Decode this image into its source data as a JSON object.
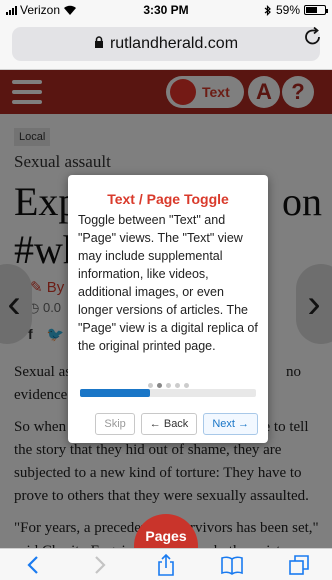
{
  "status_bar": {
    "carrier": "Verizon",
    "time": "3:30 PM",
    "battery": "59%",
    "battery_level": 0.59
  },
  "browser": {
    "url": "rutlandherald.com"
  },
  "site": {
    "toggle_label": "Text",
    "font_button": "A",
    "help_button": "?"
  },
  "article": {
    "section": "Local",
    "kicker": "Sexual assault",
    "headline_line1_left": "Exp",
    "headline_line1_right": "on",
    "headline_line2": "#wh",
    "byline": "By K",
    "dateline": "0.0",
    "para1_left": "Sexual as",
    "para1_right": "no",
    "para1_line2": "evidence",
    "para2_left": "So when",
    "para2_right": "ge to tell",
    "para2_line2": "the story that they hid out of shame, they are",
    "para2_line3": "subjected to a new kind of torture: They have to",
    "para2_line4": "prove to others that they were sexually assaulted.",
    "para3_line1": "\"For years, a precedent          rvivors has been set,\"",
    "para3_line2": "said Charity Eugair,              psychotherapist",
    "pages_button": "Pages"
  },
  "modal": {
    "title": "Text / Page Toggle",
    "body": "Toggle between \"Text\" and \"Page\" views. The \"Text\" view may include supplemental information, like videos, additional images, or even longer versions of articles. The \"Page\" view is a digital replica of the original printed page.",
    "progress": 0.4,
    "skip_label": "Skip",
    "back_label": "← Back",
    "next_label": "Next →"
  },
  "colors": {
    "brand": "#b32a22",
    "accent": "#1a76c7",
    "toggle_red": "#e8342a"
  },
  "icons": {
    "back": "chevron-left-icon",
    "forward": "chevron-right-icon",
    "share": "share-icon",
    "bookmarks": "book-icon",
    "tabs": "tabs-icon"
  }
}
